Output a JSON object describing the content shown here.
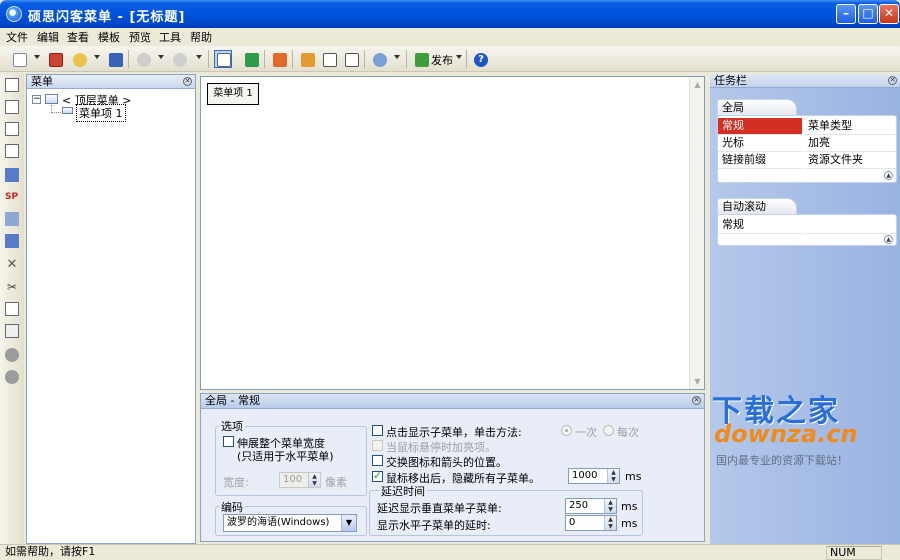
{
  "window": {
    "title": "硕思闪客菜单 - [无标题]",
    "minimize": "–",
    "maximize": "□",
    "close": "✕"
  },
  "menubar": [
    "文件",
    "编辑",
    "查看",
    "模板",
    "预览",
    "工具",
    "帮助"
  ],
  "toolbar": {
    "publish_label": "发布"
  },
  "left_panel": {
    "title": "菜单",
    "root_label": "< 顶层菜单 >",
    "child_label": "菜单项 1"
  },
  "canvas": {
    "item_label": "菜单项 1"
  },
  "properties": {
    "title": "全局 - 常规",
    "options_group": "选项",
    "stretch_label": "伸展整个菜单宽度",
    "stretch_sub": "(只适用于水平菜单)",
    "width_label": "宽度:",
    "width_value": "100",
    "width_unit": "像素",
    "encoding_group": "编码",
    "encoding_value": "波罗的海语(Windows)",
    "click_show_label": "点击显示子菜单，单击方法:",
    "radio_once": "一次",
    "radio_each": "每次",
    "highlight_label": "当鼠标悬停时加亮项。",
    "swap_label": "交换图标和箭头的位置。",
    "hide_label": "鼠标移出后，隐藏所有子菜单。",
    "hide_value": "1000",
    "unit_ms": "ms",
    "delay_group": "延迟时间",
    "vertical_delay_label": "延迟显示垂直菜单子菜单:",
    "vertical_delay_value": "250",
    "horizontal_delay_label": "显示水平子菜单的延时:",
    "horizontal_delay_value": "0"
  },
  "taskpane": {
    "title": "任务栏",
    "section1": {
      "tab": "全局",
      "rows": [
        [
          "常规",
          "菜单类型"
        ],
        [
          "光标",
          "加亮"
        ],
        [
          "链接前缀",
          "资源文件夹"
        ]
      ]
    },
    "section2": {
      "tab": "自动滚动",
      "rows": [
        [
          "常规",
          ""
        ]
      ]
    }
  },
  "watermark": {
    "line1": "下载之家",
    "line2": "downza.cn",
    "line3": "国内最专业的资源下载站！"
  },
  "statusbar": {
    "help": "如需帮助，请按F1",
    "num": "NUM"
  }
}
